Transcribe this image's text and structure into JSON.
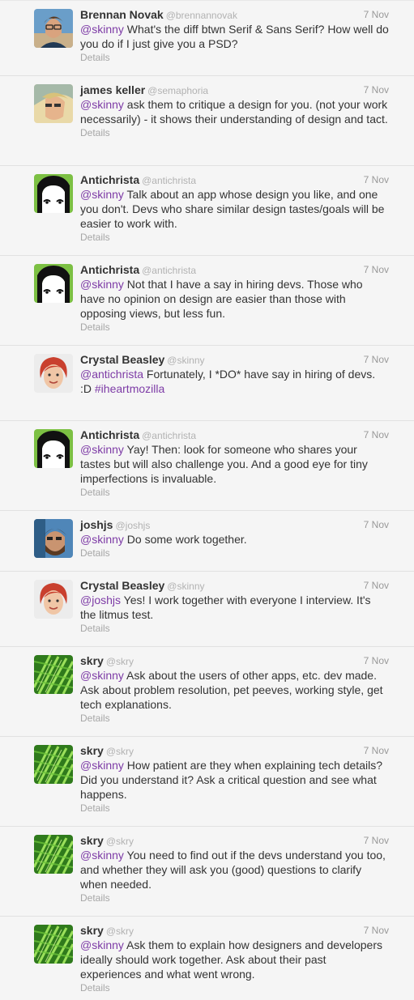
{
  "colors": {
    "background": "#f5f5f5",
    "divider": "#e1e1e1",
    "mention": "#7d3ba6",
    "name": "#333333",
    "muted": "#b2b2b2"
  },
  "tweets": [
    {
      "fullname": "Brennan Novak",
      "username": "@brennannovak",
      "time": "7 Nov",
      "mention": "@skinny",
      "text": " What's the diff btwn Serif & Sans Serif? How well do you do if I just give you a PSD?",
      "details": "Details",
      "avatar": "brennan-novak-avatar"
    },
    {
      "fullname": "james keller",
      "username": "@semaphoria",
      "time": "7 Nov",
      "mention": "@skinny",
      "text": " ask them to critique a design for you. (not your work necessarily) - it shows their understanding of design and tact.",
      "details": "Details",
      "avatar": "james-keller-avatar"
    },
    {
      "fullname": "Antichrista",
      "username": "@antichrista",
      "time": "7 Nov",
      "mention": "@skinny",
      "text": " Talk about an app whose design you like, and one you don't. Devs who share similar design tastes/goals will be easier to work with.",
      "details": "Details",
      "avatar": "antichrista-avatar"
    },
    {
      "fullname": "Antichrista",
      "username": "@antichrista",
      "time": "7 Nov",
      "mention": "@skinny",
      "text": " Not that I have a say in hiring devs. Those who have no opinion on design are easier than those with opposing views, but less fun.",
      "details": "Details",
      "avatar": "antichrista-avatar"
    },
    {
      "fullname": "Crystal Beasley",
      "username": "@skinny",
      "time": "7 Nov",
      "mention": "@antichrista",
      "text": " Fortunately, I *DO* have say in hiring of devs. :D ",
      "hashtag": "#iheartmozilla",
      "details": "",
      "avatar": "crystal-beasley-avatar"
    },
    {
      "fullname": "Antichrista",
      "username": "@antichrista",
      "time": "7 Nov",
      "mention": "@skinny",
      "text": " Yay! Then: look for someone who shares your tastes but will also challenge you. And a good eye for tiny imperfections is invaluable.",
      "details": "Details",
      "avatar": "antichrista-avatar"
    },
    {
      "fullname": "joshjs",
      "username": "@joshjs",
      "time": "7 Nov",
      "mention": "@skinny",
      "text": " Do some work together.",
      "details": "Details",
      "avatar": "joshjs-avatar"
    },
    {
      "fullname": "Crystal Beasley",
      "username": "@skinny",
      "time": "7 Nov",
      "mention": "@joshjs",
      "text": " Yes! I work together with everyone I interview. It's the litmus test.",
      "details": "Details",
      "avatar": "crystal-beasley-avatar"
    },
    {
      "fullname": "skry",
      "username": "@skry",
      "time": "7 Nov",
      "mention": "@skinny",
      "text": " Ask about the users of other apps, etc. dev made. Ask about problem resolution, pet peeves, working style, get tech explanations.",
      "details": "Details",
      "avatar": "skry-avatar"
    },
    {
      "fullname": "skry",
      "username": "@skry",
      "time": "7 Nov",
      "mention": "@skinny",
      "text": " How patient are they when explaining tech details? Did you understand it? Ask a critical question and see what happens.",
      "details": "Details",
      "avatar": "skry-avatar"
    },
    {
      "fullname": "skry",
      "username": "@skry",
      "time": "7 Nov",
      "mention": "@skinny",
      "text": " You need to find out if the devs understand you too, and whether they will ask you (good) questions to clarify when needed.",
      "details": "Details",
      "avatar": "skry-avatar"
    },
    {
      "fullname": "skry",
      "username": "@skry",
      "time": "7 Nov",
      "mention": "@skinny",
      "text": " Ask them to explain how designers and developers ideally should work together. Ask about their past experiences and what went wrong.",
      "details": "Details",
      "avatar": "skry-avatar"
    }
  ]
}
